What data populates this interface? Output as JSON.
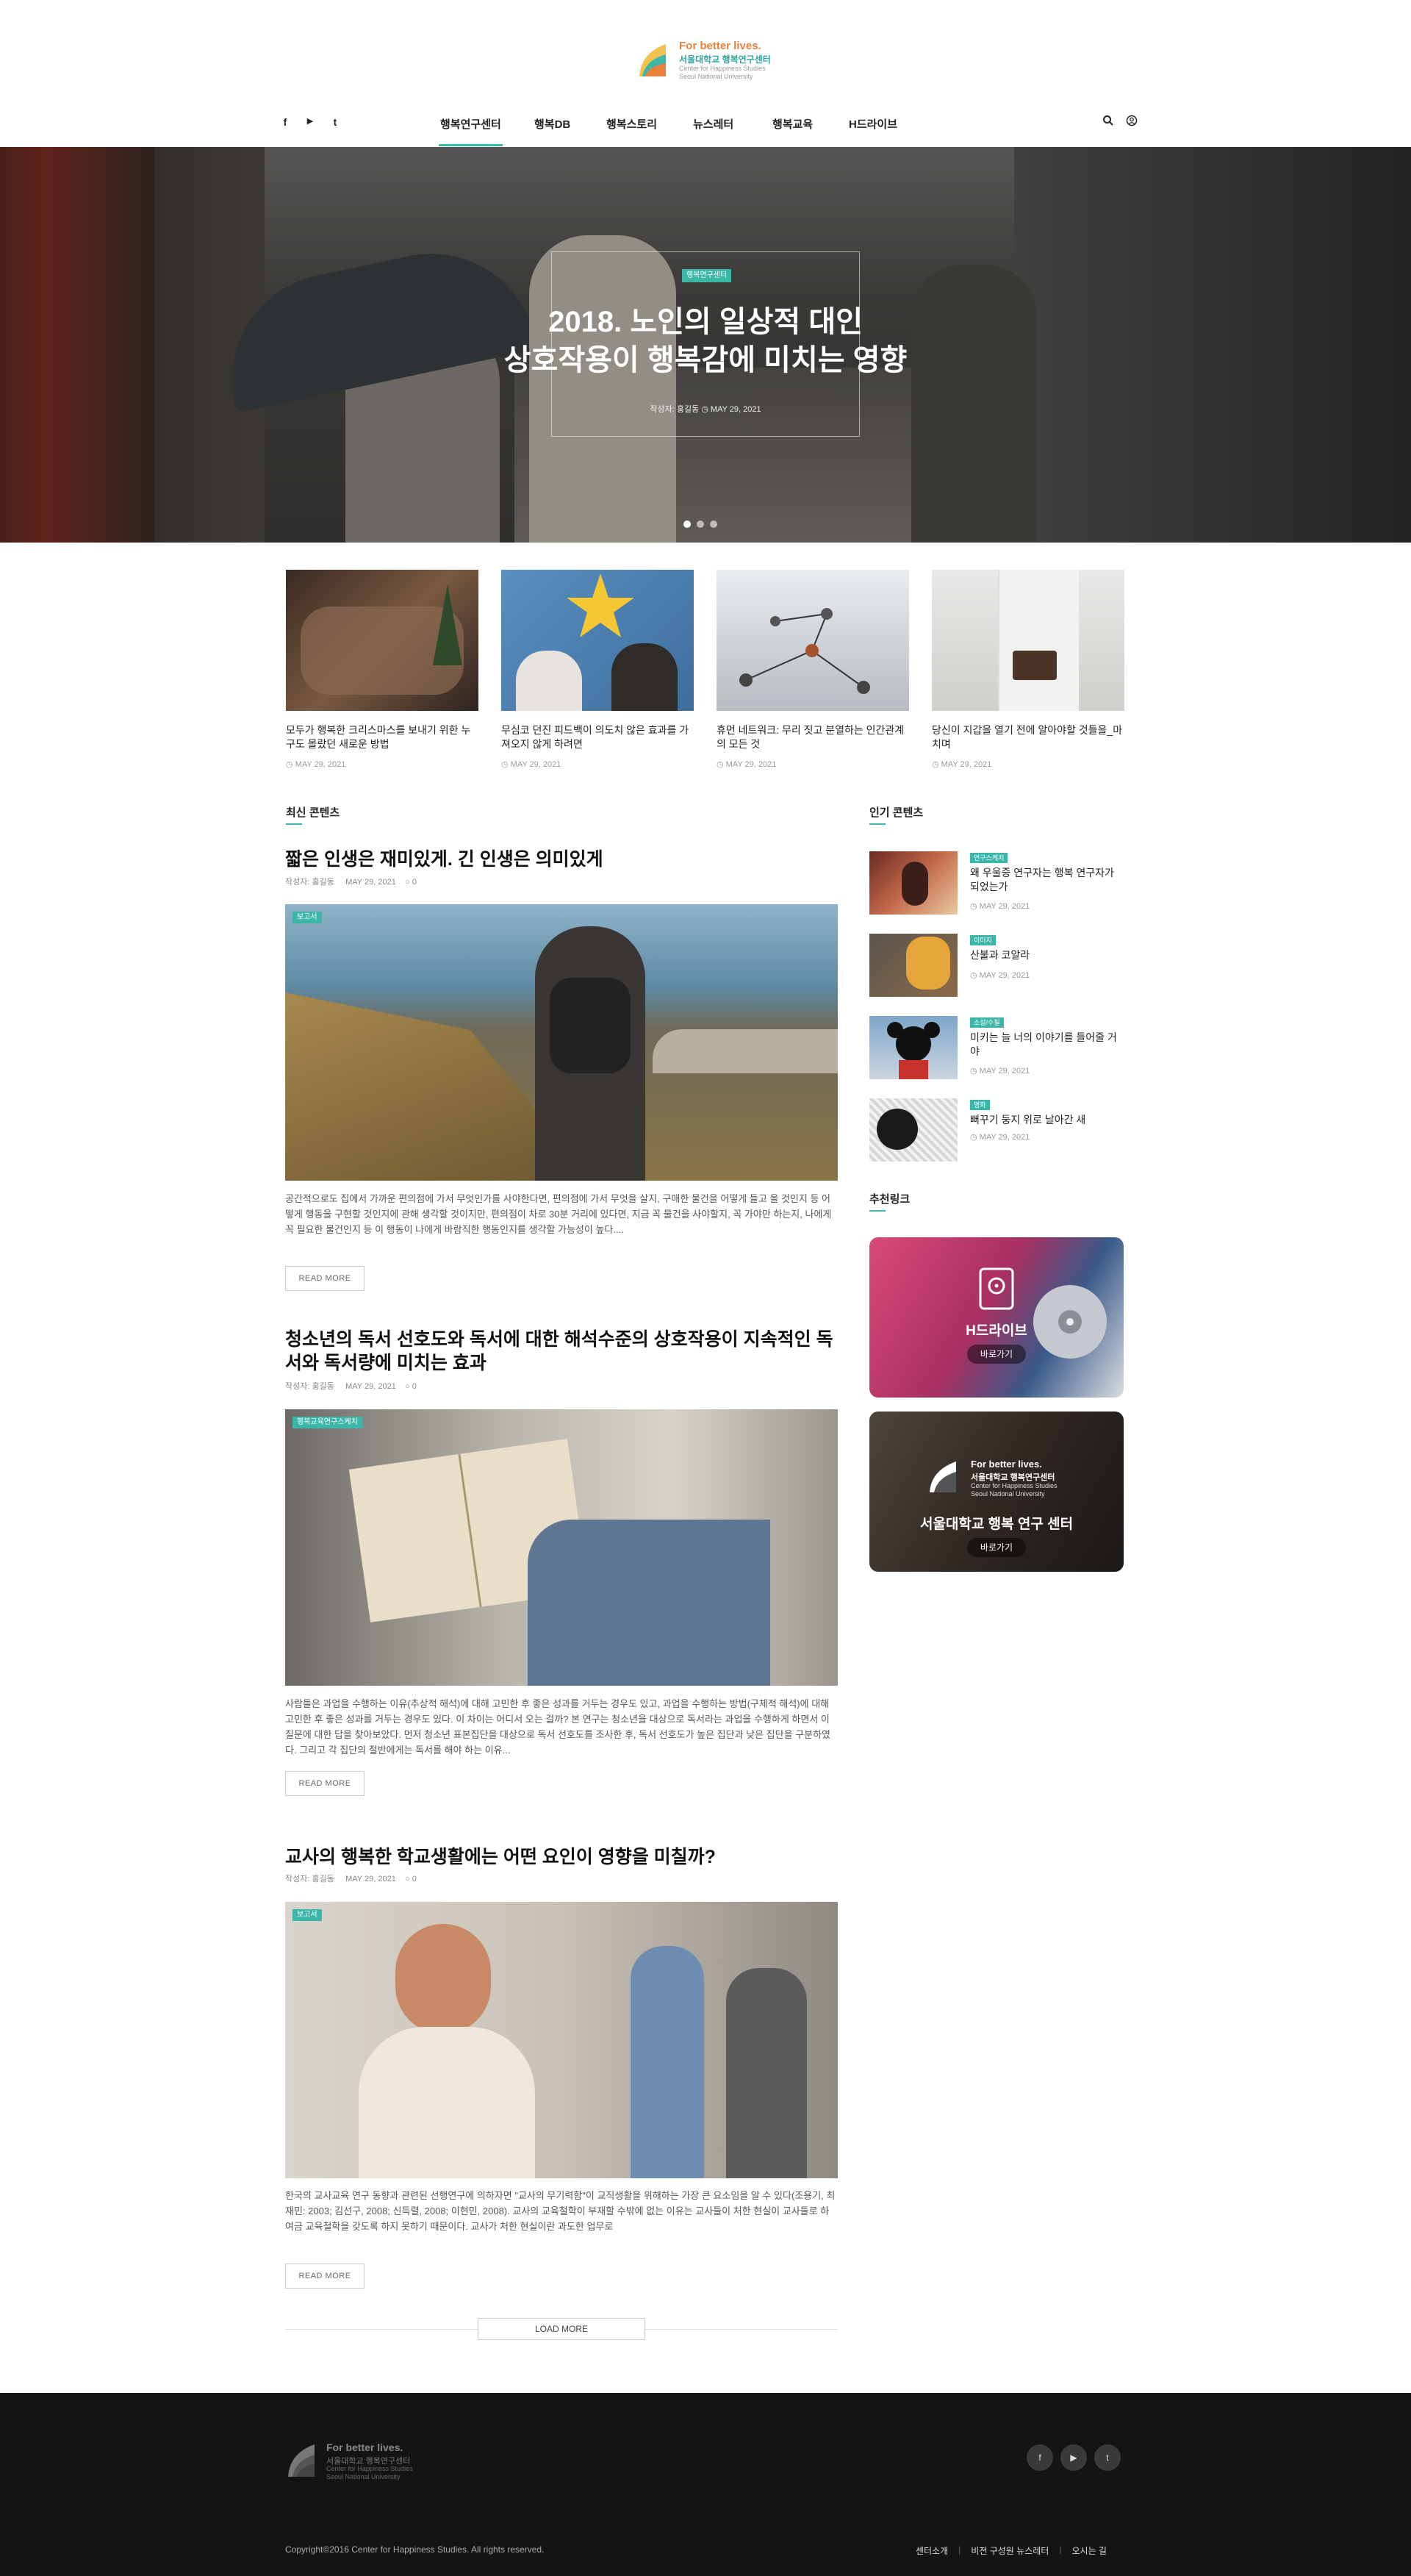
{
  "brand": {
    "line1": "For better lives.",
    "line2": "서울대학교 행복연구센터",
    "line3": "Center for Happiness Studies",
    "line4": "Seoul National University"
  },
  "social": {
    "facebook_icon": "f",
    "youtube_icon": "▶",
    "twitter_icon": "t"
  },
  "nav": {
    "items": [
      "행복연구센터",
      "행복DB",
      "행복스토리",
      "뉴스레터",
      "행복교육",
      "H드라이브"
    ],
    "active_index": 0
  },
  "hero": {
    "tag": "행복연구센터",
    "title_line1": "2018. 노인의 일상적 대인",
    "title_line2": "상호작용이 행복감에 미치는 영향",
    "meta": "작성자: 홍길동  ◷ MAY 29, 2021",
    "slides": 3,
    "active_slide": 0
  },
  "cards": [
    {
      "title": "모두가 행복한 크리스마스를 보내기 위한 누구도 몰랐던 새로운 방법",
      "date": "◷ MAY 29, 2021"
    },
    {
      "title": "무심코 던진 피드백이 의도치 않은 효과를 가져오지 않게 하려면",
      "date": "◷ MAY 29, 2021"
    },
    {
      "title": "휴먼 네트워크: 무리 짓고 분열하는 인간관계의 모든 것",
      "date": "◷ MAY 29, 2021"
    },
    {
      "title": "당신이 지갑을 열기 전에 알아야할 것들을_마치며",
      "date": "◷ MAY 29, 2021"
    }
  ],
  "latest": {
    "heading": "최신 콘텐츠",
    "posts": [
      {
        "title": "짧은 인생은 재미있게. 긴 인생은 의미있게",
        "author": "작성자: 홍길동",
        "date": "MAY 29, 2021",
        "comments": "○ 0",
        "tag": "보고서",
        "excerpt": "공간적으로도 집에서 가까운 편의점에 가서 무엇인가를 사야한다면, 편의점에 가서 무엇을 살지, 구매한 물건을 어떻게 들고 올 것인지 등 어떻게 행동을 구현할 것인지에 관해 생각할 것이지만, 편의점이 차로 30분 거리에 있다면, 지금 꼭 물건을 사야할지, 꼭 가야만 하는지, 나에게 꼭 필요한 물건인지 등 이 행동이 나에게 바람직한 행동인지를 생각할 가능성이 높다....",
        "more": "READ MORE"
      },
      {
        "title": "청소년의 독서 선호도와 독서에 대한 해석수준의 상호작용이 지속적인 독서와 독서량에 미치는 효과",
        "author": "작성자: 홍길동",
        "date": "MAY 29, 2021",
        "comments": "○ 0",
        "tag": "행복교육연구스케치",
        "excerpt": "사람들은 과업을 수행하는 이유(추상적 해석)에 대해 고민한 후 좋은 성과를 거두는 경우도 있고, 과업을 수행하는 방법(구체적 해석)에 대해 고민한 후 좋은 성과를 거두는 경우도 있다. 이 차이는 어디서 오는 걸까? 본 연구는 청소년을 대상으로 독서라는 과업을 수행하게 하면서 이 질문에 대한 답을 찾아보았다. 먼저 청소년 표본집단을 대상으로 독서 선호도를 조사한 후, 독서 선호도가 높은 집단과 낮은 집단을 구분하였다. 그리고 각 집단의 절반에게는 독서를 해야 하는 이유...",
        "more": "READ MORE"
      },
      {
        "title": "교사의 행복한 학교생활에는 어떤 요인이 영향을 미칠까?",
        "author": "작성자: 홍길동",
        "date": "MAY 29, 2021",
        "comments": "○ 0",
        "tag": "보고서",
        "excerpt": "한국의 교사교육 연구 동향과 관련된 선행연구에 의하자면 \"교사의 무기력함\"이 교직생활을 위해하는 가장 큰 요소임을 알 수 있다(조용기, 최재민: 2003; 김선구, 2008; 신득렬, 2008; 이현민, 2008). 교사의 교육철학이 부재할 수밖에 없는 이유는 교사들이 처한 현실이 교사들로 하여금 교육철학을 갖도록 하지 못하기 때문이다. 교사가 처한 현실이란 과도한 업무로",
        "more": "READ MORE"
      }
    ],
    "load_more": "LOAD MORE"
  },
  "popular": {
    "heading": "인기 콘텐츠",
    "items": [
      {
        "tag": "연구스케치",
        "title": "왜 우울증 연구자는 행복 연구자가 되었는가",
        "date": "◷ MAY 29, 2021"
      },
      {
        "tag": "이미지",
        "title": "산불과 코알라",
        "date": "◷ MAY 29, 2021"
      },
      {
        "tag": "소설/수필",
        "title": "미키는 늘 너의 이야기를 들어줄 거야",
        "date": "◷ MAY 29, 2021"
      },
      {
        "tag": "명화",
        "title": "뻐꾸기 둥지 위로 날아간 새",
        "date": "◷ MAY 29, 2021"
      }
    ]
  },
  "links": {
    "heading": "추천링크",
    "hdrive": {
      "title": "H드라이브",
      "go": "바로가기"
    },
    "center": {
      "line1": "For better lives.",
      "line2": "서울대학교 행복연구센터",
      "line3": "Center for Happiness Studies",
      "line4": "Seoul National University",
      "title": "서울대학교 행복 연구 센터",
      "go": "바로가기"
    }
  },
  "footer": {
    "copyright": "Copyright©2016 Center for Happiness Studies. All rights reserved.",
    "links": [
      "센터소개",
      "비전 구성원 뉴스레터",
      "오시는 길"
    ],
    "sep": "|"
  },
  "colors": {
    "accent": "#3bb6a8",
    "brand_orange": "#e8803a",
    "footer_bg": "#141414"
  }
}
